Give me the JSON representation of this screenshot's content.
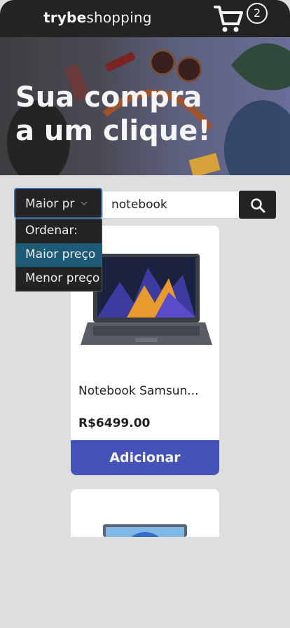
{
  "header": {
    "brand_bold": "trybe",
    "brand_regular": "shopping",
    "cart_count": "2",
    "cart_icon": "shopping-cart-icon"
  },
  "hero": {
    "title_line1": "Sua compra",
    "title_line2": "a um clique!"
  },
  "search": {
    "sort_selected": "Maior pr",
    "query_value": "notebook",
    "search_icon": "search-icon"
  },
  "sort_options": [
    {
      "label": "Ordenar:",
      "selected": false
    },
    {
      "label": "Maior preço",
      "selected": true
    },
    {
      "label": "Menor preço",
      "selected": false
    }
  ],
  "products": [
    {
      "name": "Notebook Samsun...",
      "price": "R$6499.00",
      "add_label": "Adicionar"
    }
  ],
  "colors": {
    "header_bg": "#232323",
    "accent": "#4552b8",
    "selected_option": "#1d5a78",
    "page_bg": "#dedede"
  }
}
